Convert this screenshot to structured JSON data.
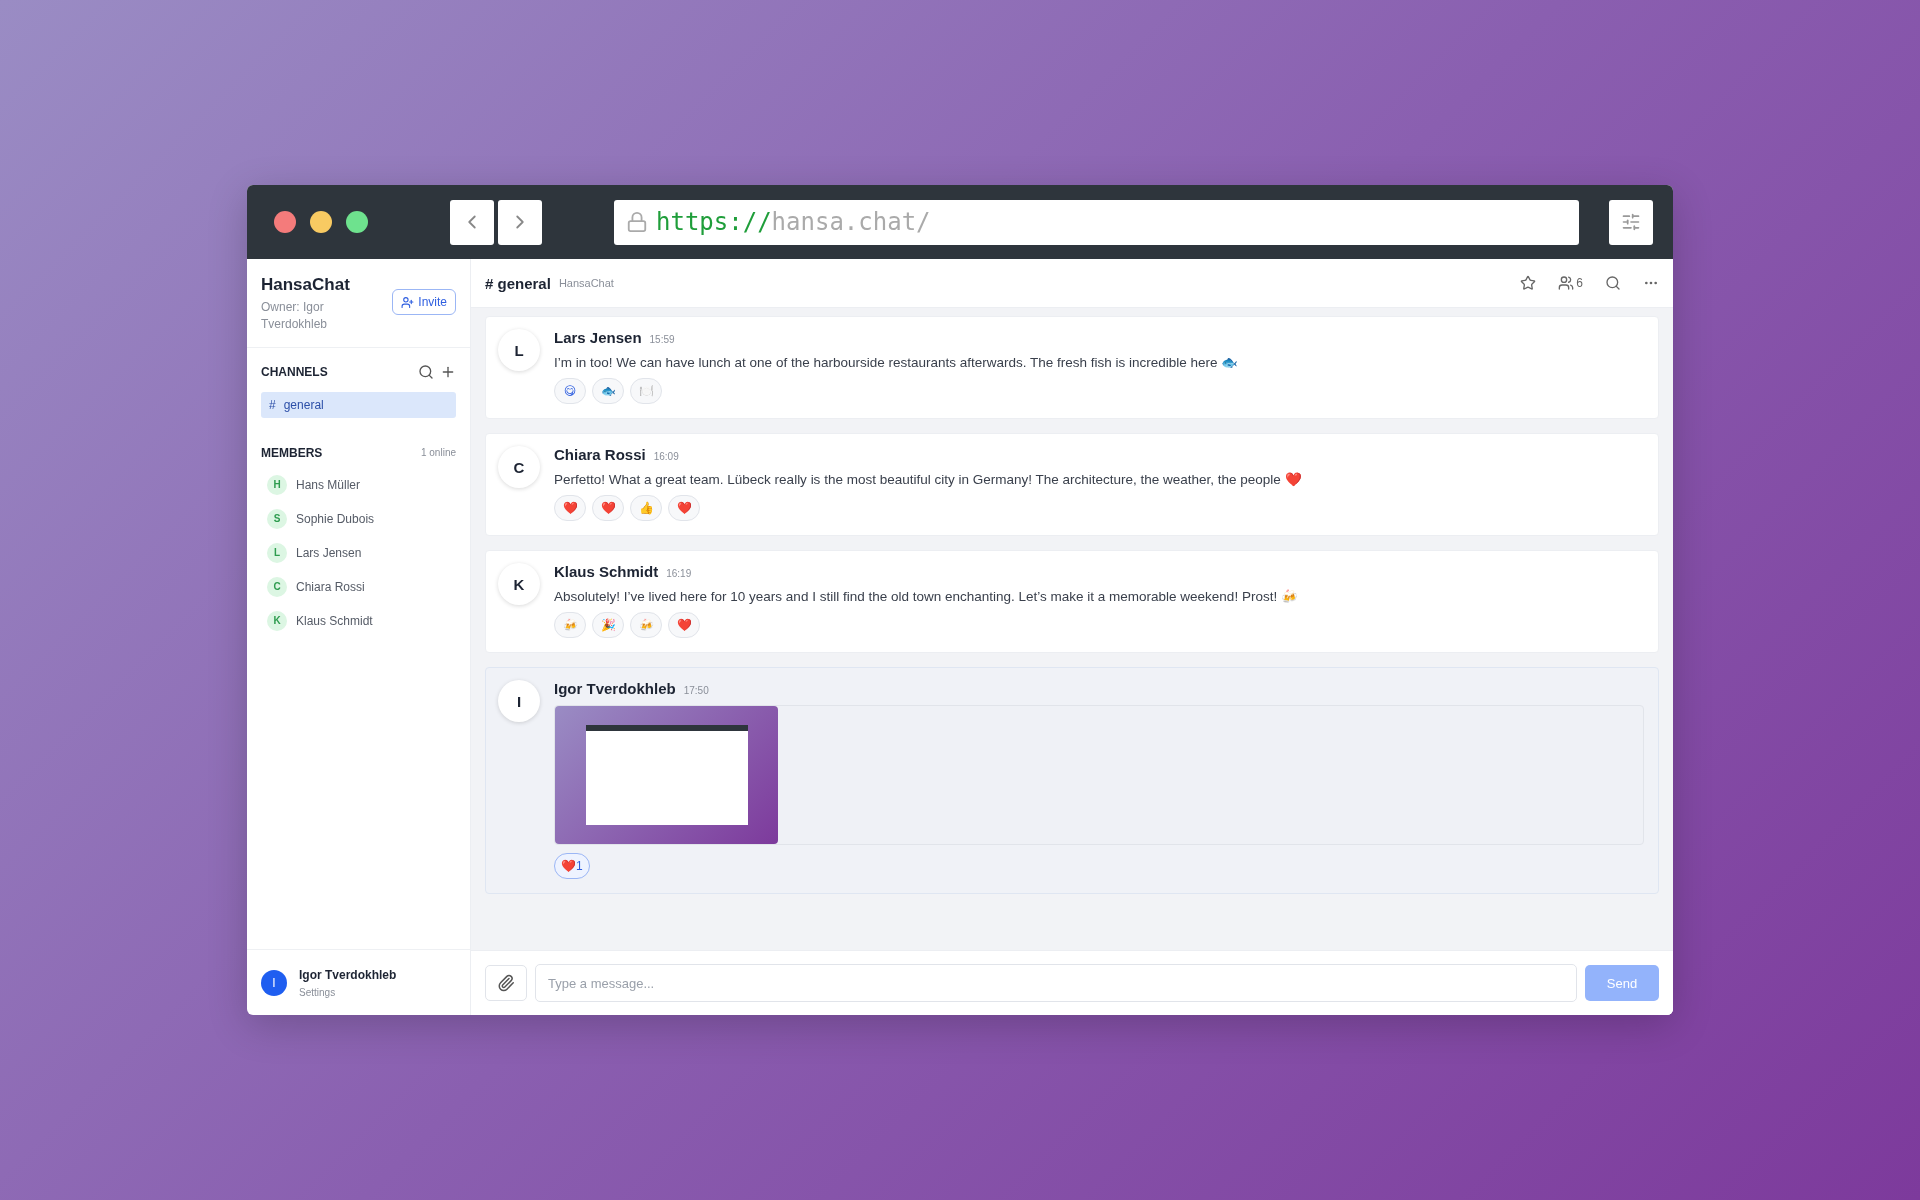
{
  "browser": {
    "url_scheme": "https://",
    "url_host": "hansa.chat/"
  },
  "sidebar": {
    "workspace": "HansaChat",
    "owner": "Owner: Igor Tverdokhleb",
    "invite": "Invite",
    "channels_heading": "CHANNELS",
    "channels": [
      {
        "hash": "#",
        "name": "general",
        "selected": true
      }
    ],
    "members_heading": "MEMBERS",
    "online": "1 online",
    "members": [
      {
        "initial": "H",
        "name": "Hans Müller"
      },
      {
        "initial": "S",
        "name": "Sophie Dubois"
      },
      {
        "initial": "L",
        "name": "Lars Jensen"
      },
      {
        "initial": "C",
        "name": "Chiara Rossi"
      },
      {
        "initial": "K",
        "name": "Klaus Schmidt"
      }
    ],
    "user": {
      "initial": "I",
      "name": "Igor Tverdokhleb",
      "link": "Settings"
    }
  },
  "header": {
    "channel": "# general",
    "workspace": "HansaChat",
    "member_count": "6"
  },
  "messages": [
    {
      "kind": "text",
      "initial": "L",
      "author": "Lars Jensen",
      "time": "15:59",
      "text": "I’m in too! We can have lunch at one of the harbourside restaurants afterwards. The fresh fish is incredible here 🐟",
      "own": false,
      "reactions": [
        {
          "emoji": "😋",
          "selected": false
        },
        {
          "emoji": "🐟",
          "selected": false
        },
        {
          "emoji": "🍽️",
          "selected": false
        }
      ]
    },
    {
      "kind": "text",
      "initial": "C",
      "author": "Chiara Rossi",
      "time": "16:09",
      "text": "Perfetto! What a great team. Lübeck really is the most beautiful city in Germany! The architecture, the weather, the people ❤️",
      "own": false,
      "reactions": [
        {
          "emoji": "❤️",
          "selected": false
        },
        {
          "emoji": "❤️",
          "selected": false
        },
        {
          "emoji": "👍",
          "selected": false
        },
        {
          "emoji": "❤️",
          "selected": false
        }
      ]
    },
    {
      "kind": "text",
      "initial": "K",
      "author": "Klaus Schmidt",
      "time": "16:19",
      "text": "Absolutely! I’ve lived here for 10 years and I still find the old town enchanting. Let’s make it a memorable weekend! Prost! 🍻",
      "own": false,
      "reactions": [
        {
          "emoji": "🍻",
          "selected": false
        },
        {
          "emoji": "🎉",
          "selected": false
        },
        {
          "emoji": "🍻",
          "selected": false
        },
        {
          "emoji": "❤️",
          "selected": false
        }
      ]
    },
    {
      "kind": "image",
      "initial": "I",
      "author": "Igor Tverdokhleb",
      "time": "17:50",
      "own": true,
      "reactions": [
        {
          "emoji": "❤️",
          "count": "1",
          "selected": true
        }
      ]
    }
  ],
  "composer": {
    "placeholder": "Type a message...",
    "send": "Send"
  }
}
